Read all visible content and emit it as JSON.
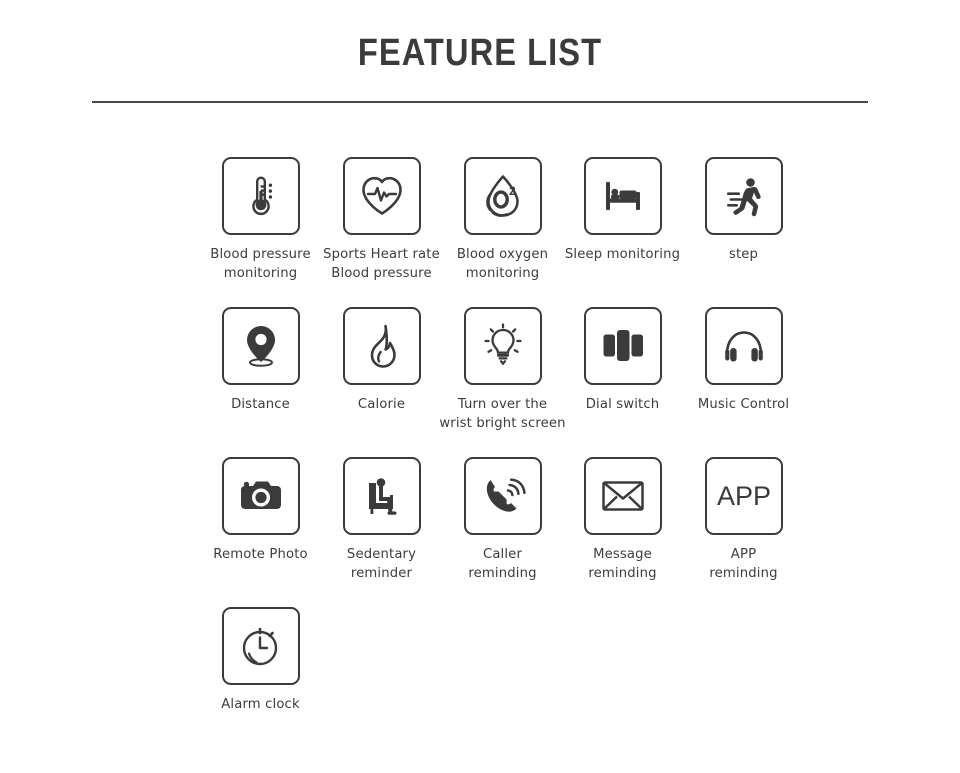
{
  "header": {
    "title": "FEATURE LIST",
    "divider_color": "#4a4a4a"
  },
  "theme": {
    "background": "#ffffff",
    "ink": "#3b3b3b",
    "label_color": "#3d3d3d",
    "box_border": "#3b3b3b"
  },
  "features": [
    {
      "id": "blood-pressure-monitoring",
      "icon": "thermometer-icon",
      "label": "Blood pressure\nmonitoring",
      "row": 0,
      "col": 0
    },
    {
      "id": "sports-heart-rate-blood-pressure",
      "icon": "heart-pulse-icon",
      "label": "Sports Heart rate\nBlood pressure",
      "row": 0,
      "col": 1
    },
    {
      "id": "blood-oxygen-monitoring",
      "icon": "blood-oxygen-drop-icon",
      "label": "Blood oxygen\nmonitoring",
      "row": 0,
      "col": 2
    },
    {
      "id": "sleep-monitoring",
      "icon": "bed-icon",
      "label": "Sleep monitoring",
      "row": 0,
      "col": 3
    },
    {
      "id": "step",
      "icon": "running-person-icon",
      "label": "step",
      "row": 0,
      "col": 4
    },
    {
      "id": "distance",
      "icon": "location-pin-icon",
      "label": "Distance",
      "row": 1,
      "col": 0
    },
    {
      "id": "calorie",
      "icon": "flame-icon",
      "label": "Calorie",
      "row": 1,
      "col": 1
    },
    {
      "id": "turn-over-the-wrist-bright-screen",
      "icon": "lightbulb-icon",
      "label": "Turn over the\nwrist bright screen",
      "row": 1,
      "col": 2
    },
    {
      "id": "dial-switch",
      "icon": "dial-switch-icon",
      "label": "Dial switch",
      "row": 1,
      "col": 3
    },
    {
      "id": "music-control",
      "icon": "headphones-icon",
      "label": "Music Control",
      "row": 1,
      "col": 4
    },
    {
      "id": "remote-photo",
      "icon": "camera-icon",
      "label": "Remote Photo",
      "row": 2,
      "col": 0
    },
    {
      "id": "sedentary-reminder",
      "icon": "sitting-person-icon",
      "label": "Sedentary\nreminder",
      "row": 2,
      "col": 1
    },
    {
      "id": "caller-reminding",
      "icon": "phone-ringing-icon",
      "label": "Caller\nreminding",
      "row": 2,
      "col": 2
    },
    {
      "id": "message-reminding",
      "icon": "envelope-icon",
      "label": "Message\nreminding",
      "row": 2,
      "col": 3
    },
    {
      "id": "app-reminding",
      "icon": "app-text-icon",
      "label": "APP\nreminding",
      "row": 2,
      "col": 4
    },
    {
      "id": "alarm-clock",
      "icon": "stopwatch-icon",
      "label": "Alarm clock",
      "row": 3,
      "col": 0
    }
  ],
  "icon_glyphs": {
    "app_text": "APP",
    "blood_oxygen_text": "O",
    "blood_oxygen_superscript": "2"
  }
}
